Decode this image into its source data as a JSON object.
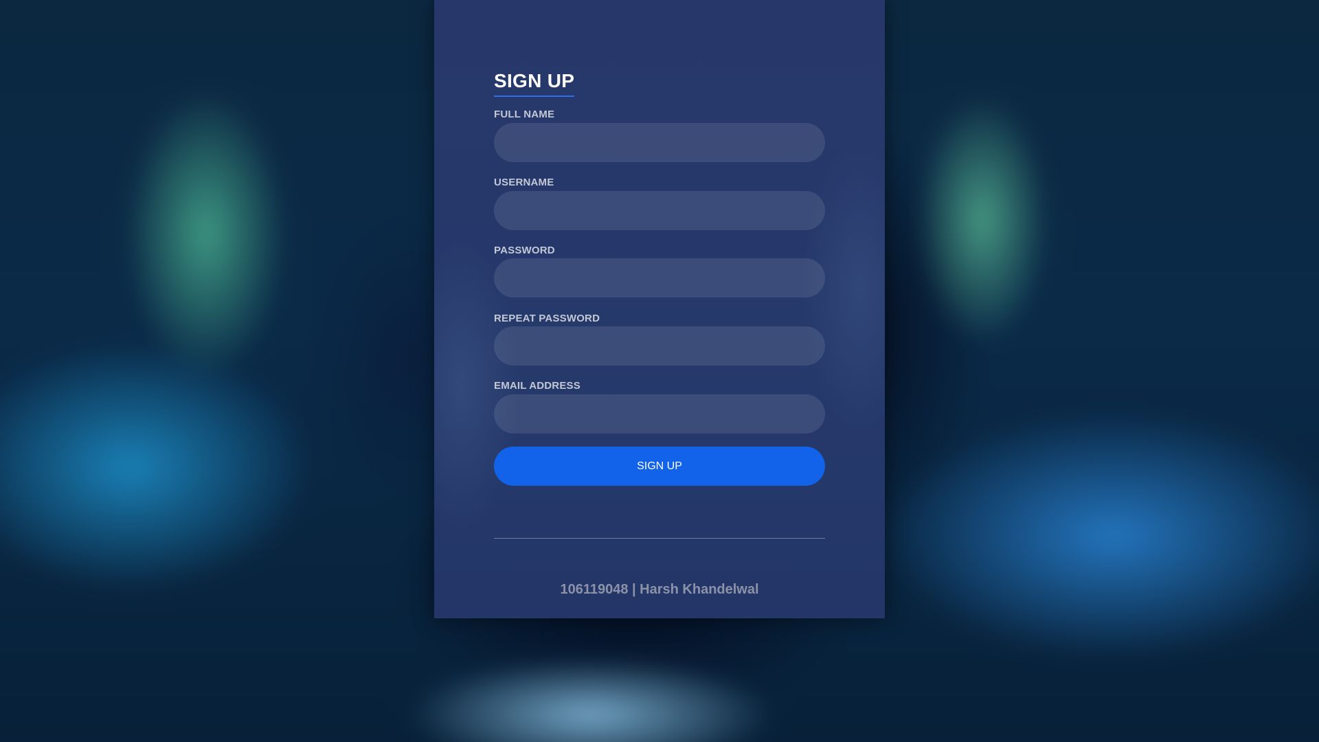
{
  "form": {
    "title": "SIGN UP",
    "fields": [
      {
        "label": "FULL NAME",
        "value": ""
      },
      {
        "label": "USERNAME",
        "value": ""
      },
      {
        "label": "PASSWORD",
        "value": ""
      },
      {
        "label": "REPEAT PASSWORD",
        "value": ""
      },
      {
        "label": "EMAIL ADDRESS",
        "value": ""
      }
    ],
    "submit_label": "SIGN UP"
  },
  "footer": {
    "text": "106119048 | Harsh Khandelwal"
  },
  "colors": {
    "card": "#26386a",
    "accent": "#1262ea",
    "label": "#c2c8d6",
    "footer_text": "#8c93a9"
  }
}
